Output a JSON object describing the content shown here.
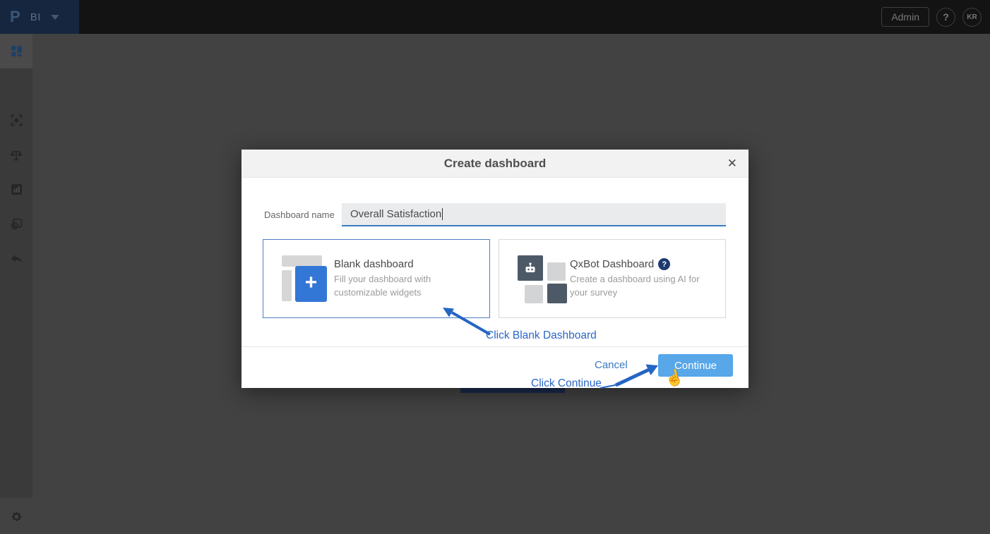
{
  "topbar": {
    "logo": "P",
    "product": "BI",
    "admin_label": "Admin",
    "help_label": "?",
    "avatar_initials": "KR"
  },
  "sidebar": {
    "items": [
      {
        "icon": "dashboards-grid-icon",
        "active": true
      },
      {
        "icon": "scan-focus-icon",
        "active": false
      },
      {
        "icon": "balance-scale-icon",
        "active": false
      },
      {
        "icon": "bar-chart-icon",
        "active": false
      },
      {
        "icon": "sync-document-icon",
        "active": false
      },
      {
        "icon": "undo-arrow-icon",
        "active": false
      },
      {
        "icon": "settings-gear-icon",
        "active": false
      }
    ]
  },
  "modal": {
    "title": "Create dashboard",
    "close_label": "✕",
    "name_field": {
      "label": "Dashboard name",
      "value": "Overall Satisfaction"
    },
    "options": [
      {
        "title": "Blank dashboard",
        "description": "Fill your dashboard with customizable widgets",
        "selected": true,
        "icon": "blank-dashboard-plus-icon"
      },
      {
        "title": "QxBot Dashboard",
        "help_badge": "?",
        "description": "Create a dashboard using AI for your survey",
        "selected": false,
        "icon": "qxbot-grid-icon"
      }
    ],
    "cancel_label": "Cancel",
    "continue_label": "Continue"
  },
  "annotations": {
    "blank_note": "Click Blank Dashboard",
    "continue_note": "Click Continue"
  },
  "colors": {
    "accent_blue": "#3377d6",
    "selected_border": "#4c7ec6",
    "continue_button": "#57a7e9",
    "link_blue": "#3879be",
    "annotation_blue": "#2b66c5",
    "input_underline": "#3a7cc0",
    "brand_navy": "#16263e",
    "dark_slate": "#4d5966"
  }
}
